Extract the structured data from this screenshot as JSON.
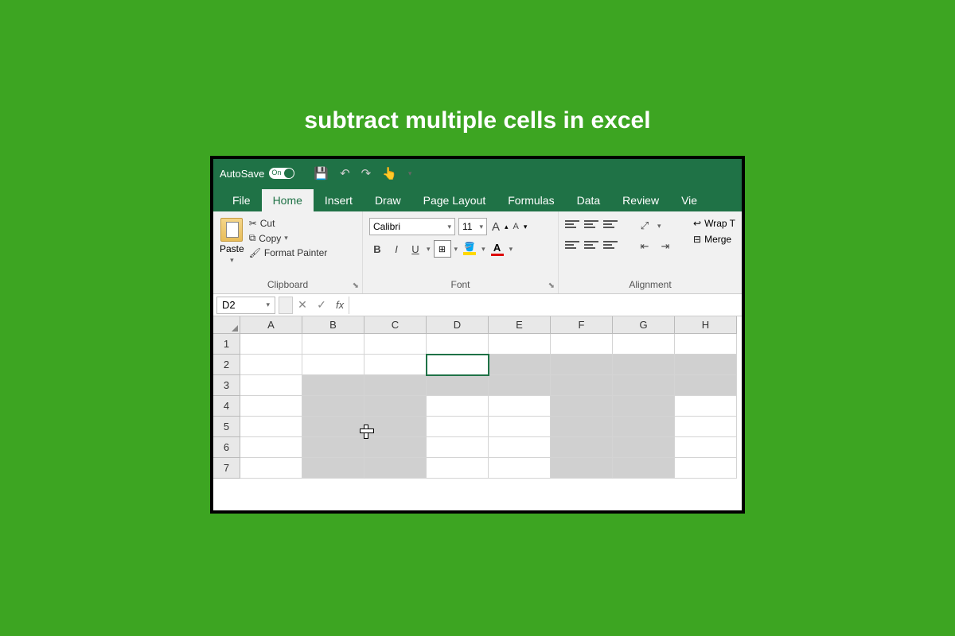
{
  "page": {
    "title": "subtract multiple cells in excel"
  },
  "titlebar": {
    "autosave_label": "AutoSave",
    "toggle_text": "On"
  },
  "tabs": {
    "file": "File",
    "home": "Home",
    "insert": "Insert",
    "draw": "Draw",
    "page_layout": "Page Layout",
    "formulas": "Formulas",
    "data": "Data",
    "review": "Review",
    "view": "Vie"
  },
  "ribbon": {
    "clipboard": {
      "paste": "Paste",
      "cut": "Cut",
      "copy": "Copy",
      "format_painter": "Format Painter",
      "group": "Clipboard"
    },
    "font": {
      "name": "Calibri",
      "size": "11",
      "group": "Font",
      "bold": "B",
      "italic": "I",
      "underline": "U",
      "increase": "A",
      "decrease": "A",
      "font_color": "A"
    },
    "alignment": {
      "group": "Alignment",
      "wrap": "Wrap T",
      "merge": "Merge"
    }
  },
  "formula_bar": {
    "name_box": "D2",
    "fx": "fx"
  },
  "grid": {
    "columns": [
      "A",
      "B",
      "C",
      "D",
      "E",
      "F",
      "G",
      "H"
    ],
    "rows": [
      "1",
      "2",
      "3",
      "4",
      "5",
      "6",
      "7"
    ],
    "active_cell": "D2"
  }
}
